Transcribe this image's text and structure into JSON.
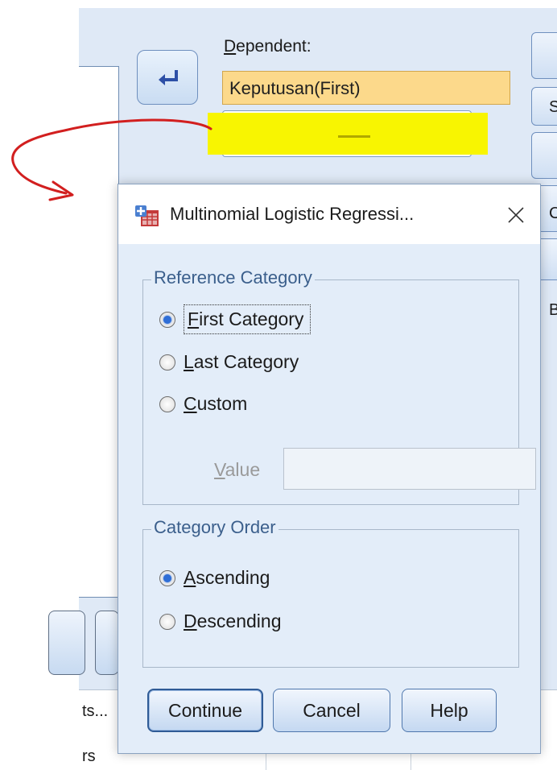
{
  "parent_dialog": {
    "dependent_label": "Dependent:",
    "dependent_value": "Keputusan(First)",
    "cell_1": "ts...",
    "cell_2": "rs"
  },
  "dialog": {
    "title": "Multinomial Logistic Regressi...",
    "reference_group": {
      "title": "Reference Category",
      "options": [
        {
          "label": "First Category",
          "checked": true
        },
        {
          "label": "Last Category",
          "checked": false
        },
        {
          "label": "Custom",
          "checked": false
        }
      ],
      "value_label": "Value",
      "value_placeholder": ""
    },
    "order_group": {
      "title": "Category Order",
      "options": [
        {
          "label": "Ascending",
          "checked": true
        },
        {
          "label": "Descending",
          "checked": false
        }
      ]
    },
    "buttons": {
      "continue": "Continue",
      "cancel": "Cancel",
      "help": "Help"
    }
  },
  "colors": {
    "dialog_bg": "#e3edf9",
    "group_title": "#3b5f8c",
    "dependent_highlight": "#fcd98b",
    "annotation_yellow": "#f8f501",
    "annotation_red": "#d21f1f"
  }
}
